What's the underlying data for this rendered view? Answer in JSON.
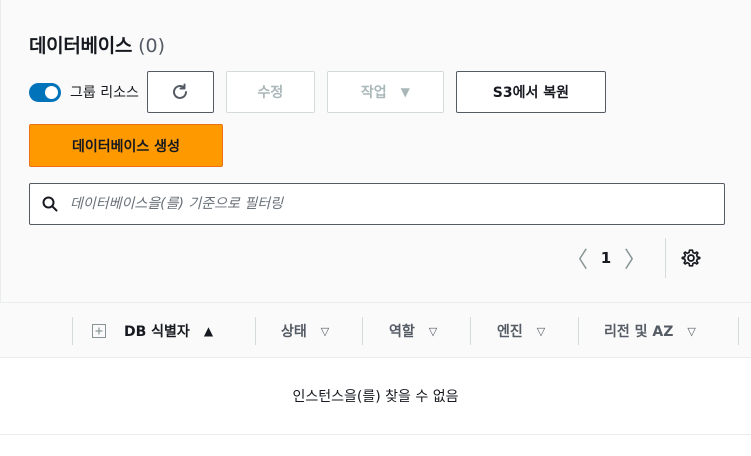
{
  "header": {
    "title": "데이터베이스",
    "count": "(0)"
  },
  "toolbar": {
    "group_toggle_label": "그룹 리소스",
    "group_toggle_on": true,
    "refresh_icon": "refresh-icon",
    "edit_label": "수정",
    "actions_label": "작업",
    "actions_caret": "▼",
    "restore_label": "S3에서 복원",
    "create_label": "데이터베이스 생성"
  },
  "search": {
    "placeholder": "데이터베이스을(를) 기준으로 필터링",
    "value": ""
  },
  "pagination": {
    "prev": "〈",
    "current_page": "1",
    "next": "〉",
    "settings_icon": "gear-icon"
  },
  "table": {
    "columns": [
      {
        "label": "DB 식별자",
        "sort": "▲",
        "sorted": true
      },
      {
        "label": "상태",
        "sort": "▽",
        "sorted": false
      },
      {
        "label": "역할",
        "sort": "▽",
        "sorted": false
      },
      {
        "label": "엔진",
        "sort": "▽",
        "sorted": false
      },
      {
        "label": "리전 및 AZ",
        "sort": "▽",
        "sorted": false
      }
    ],
    "empty_message": "인스턴스을(를) 찾을 수 없음"
  },
  "colors": {
    "primary": "#ff9900",
    "toggle_on": "#0073bb",
    "border": "#545b64"
  }
}
